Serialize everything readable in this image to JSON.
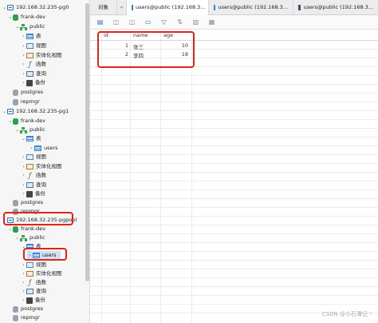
{
  "tree": {
    "servers": [
      {
        "label": "192.168.32.235-pg0",
        "db": "frank-dev",
        "schema": "public",
        "items": [
          "表",
          "视图",
          "实体化视图",
          "函数",
          "查询",
          "备份"
        ],
        "other_dbs": [
          "postgres",
          "repmgr"
        ]
      },
      {
        "label": "192.168.32.235-pg1",
        "db": "frank-dev",
        "schema": "public",
        "table_group": "表",
        "table": "users",
        "items": [
          "视图",
          "实体化视图",
          "函数",
          "查询",
          "备份"
        ],
        "other_dbs": [
          "postgres",
          "repmgr"
        ]
      },
      {
        "label": "192.168.32.235-pgpool",
        "db": "frank-dev",
        "schema": "public",
        "table_group": "表",
        "table": "users",
        "items": [
          "视图",
          "实体化视图",
          "函数",
          "查询",
          "备份"
        ],
        "other_dbs": [
          "postgres",
          "repmgr"
        ]
      }
    ]
  },
  "tabs": [
    {
      "label": "对象"
    },
    {
      "label": "users@public (192.168.3..."
    },
    {
      "label": "users@public (192.168.3..."
    },
    {
      "label": "users@public (192.168.3..."
    }
  ],
  "table": {
    "columns": [
      "id",
      "name",
      "age"
    ],
    "rows": [
      [
        "1",
        "张三",
        "10"
      ],
      [
        "2",
        "李四",
        "18"
      ]
    ]
  },
  "watermark": "CSDN @小石潭记丶"
}
